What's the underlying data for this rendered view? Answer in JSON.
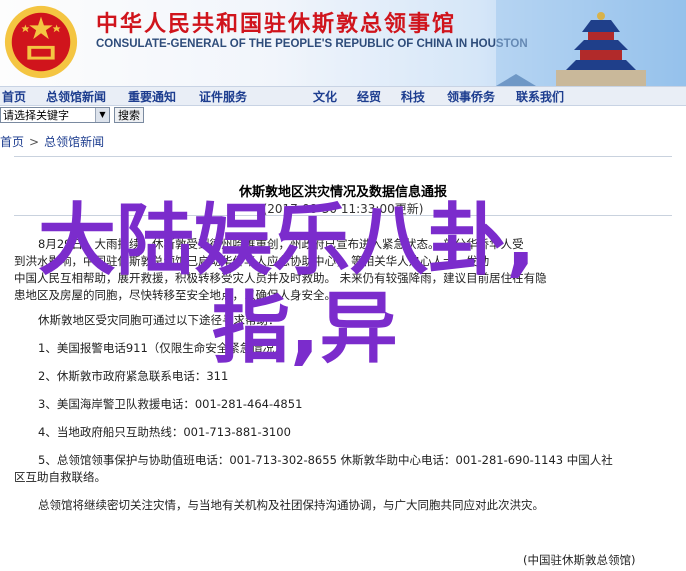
{
  "header": {
    "title_cn": "中华人民共和国驻休斯敦总领事馆",
    "title_en": "CONSULATE-GENERAL OF THE PEOPLE'S REPUBLIC OF CHINA IN HOUSTON"
  },
  "nav": {
    "items": [
      "首页",
      "总领馆新闻",
      "重要通知",
      "证件服务",
      "文化",
      "经贸",
      "科技",
      "领事侨务",
      "联系我们"
    ]
  },
  "search": {
    "selected": "请选择关键字",
    "button": "搜索"
  },
  "breadcrumb": [
    "首页",
    "总领馆新闻"
  ],
  "article": {
    "title": "休斯敦地区洪灾情况及数据信息通报",
    "date": "(2017-08-30 11:33:00更新)",
    "p1_l1": "8月29日，大雨持续，休斯敦受到德州哈维重创，州政府已宣布进入紧急状态。  部分华侨华人受",
    "p1_l2": "到洪水影响，中国驻休斯敦总领馆已启动华侨华人应急协助中心，  等相关华人热心人士，发动",
    "p1_l3": "中国人民互相帮助，展开救援，积极转移受灾人员并及时救助。  未来仍有较强降雨，建议目前居住在有隐",
    "p1_l4": "患地区及房屋的同胞，尽快转移至安全地点，以确保人身安全。",
    "p2": "休斯敦地区受灾同胞可通过以下途径寻求帮助：",
    "i1": "1、美国报警电话911（仅限生命安全紧急情况）",
    "i2": "2、休斯敦市政府紧急联系电话：311",
    "i3": "3、美国海岸警卫队救援电话：001-281-464-4851",
    "i4": "4、当地政府船只互助热线：001-713-881-3100",
    "i5a": "5、总领馆领事保护与协助值班电话：001-713-302-8655 休斯敦华助中心电话：001-281-690-1143  中国人社",
    "i5b": "区互助自救联络。",
    "p3": "总领馆将继续密切关注灾情，与当地有关机构及社团保持沟通协调，与广大同胞共同应对此次洪灾。",
    "signature": "(中国驻休斯敦总领馆)"
  },
  "overlay": {
    "line1": "大陆娱乐八卦,",
    "line2": "指,异"
  },
  "colors": {
    "title_red": "#d0141c",
    "nav_blue": "#1d3d8f",
    "overlay_purple": "#7b2ccc"
  }
}
